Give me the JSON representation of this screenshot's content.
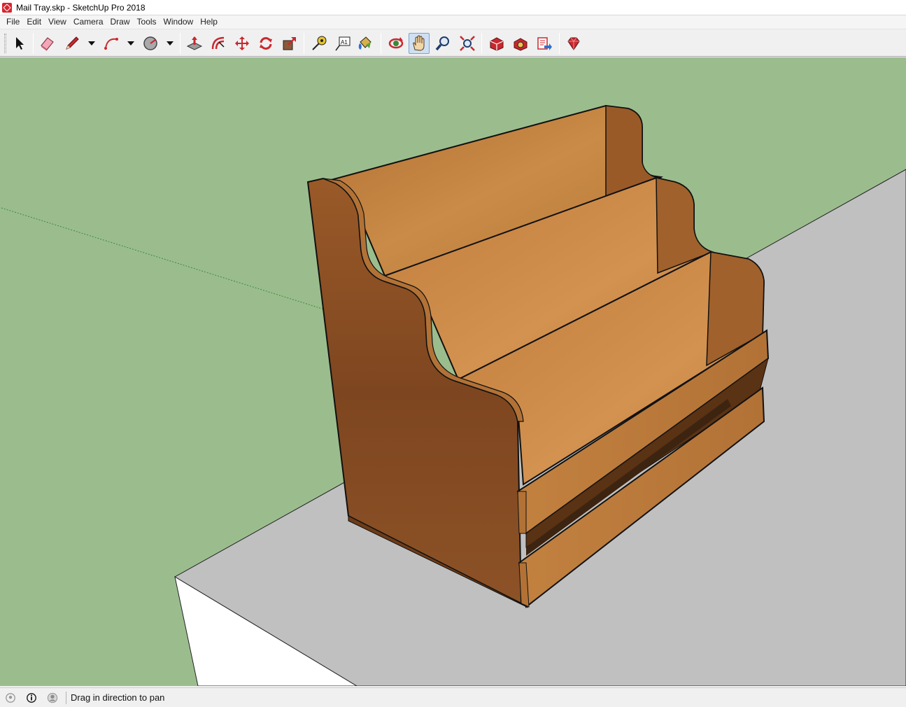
{
  "window": {
    "title": "Mail Tray.skp - SketchUp Pro 2018"
  },
  "menu": [
    "File",
    "Edit",
    "View",
    "Camera",
    "Draw",
    "Tools",
    "Window",
    "Help"
  ],
  "toolbar": {
    "tools": [
      {
        "id": "select",
        "icon": "select-arrow-icon"
      },
      {
        "id": "eraser",
        "icon": "eraser-icon"
      },
      {
        "id": "line",
        "icon": "pencil-icon"
      },
      {
        "id": "arc",
        "icon": "arc-icon"
      },
      {
        "id": "shape",
        "icon": "circle-shape-icon"
      },
      {
        "id": "push-pull",
        "icon": "push-pull-icon"
      },
      {
        "id": "offset",
        "icon": "offset-icon"
      },
      {
        "id": "move",
        "icon": "move-icon"
      },
      {
        "id": "rotate",
        "icon": "rotate-icon"
      },
      {
        "id": "scale",
        "icon": "scale-icon"
      },
      {
        "id": "tape-measure",
        "icon": "tape-measure-icon"
      },
      {
        "id": "text",
        "icon": "text-label-icon"
      },
      {
        "id": "paint-bucket",
        "icon": "paint-bucket-icon"
      },
      {
        "id": "orbit",
        "icon": "orbit-icon"
      },
      {
        "id": "pan",
        "icon": "pan-hand-icon",
        "active": true
      },
      {
        "id": "zoom",
        "icon": "zoom-icon"
      },
      {
        "id": "zoom-extents",
        "icon": "zoom-extents-icon"
      },
      {
        "id": "3d-warehouse",
        "icon": "warehouse-icon"
      },
      {
        "id": "extension-warehouse",
        "icon": "extension-warehouse-icon"
      },
      {
        "id": "layout",
        "icon": "send-to-layout-icon"
      },
      {
        "id": "ruby-console",
        "icon": "ruby-icon"
      }
    ],
    "text_label_glyph": "A1"
  },
  "colors": {
    "sky": "#9bbd8e",
    "ground": "#c0c0c0",
    "table_side": "#ffffff",
    "wood_light": "#c7853f",
    "wood_dark": "#8a4d22",
    "edge": "#111111",
    "accent": "#d7262f"
  },
  "status": {
    "text": "Drag in direction to pan"
  }
}
